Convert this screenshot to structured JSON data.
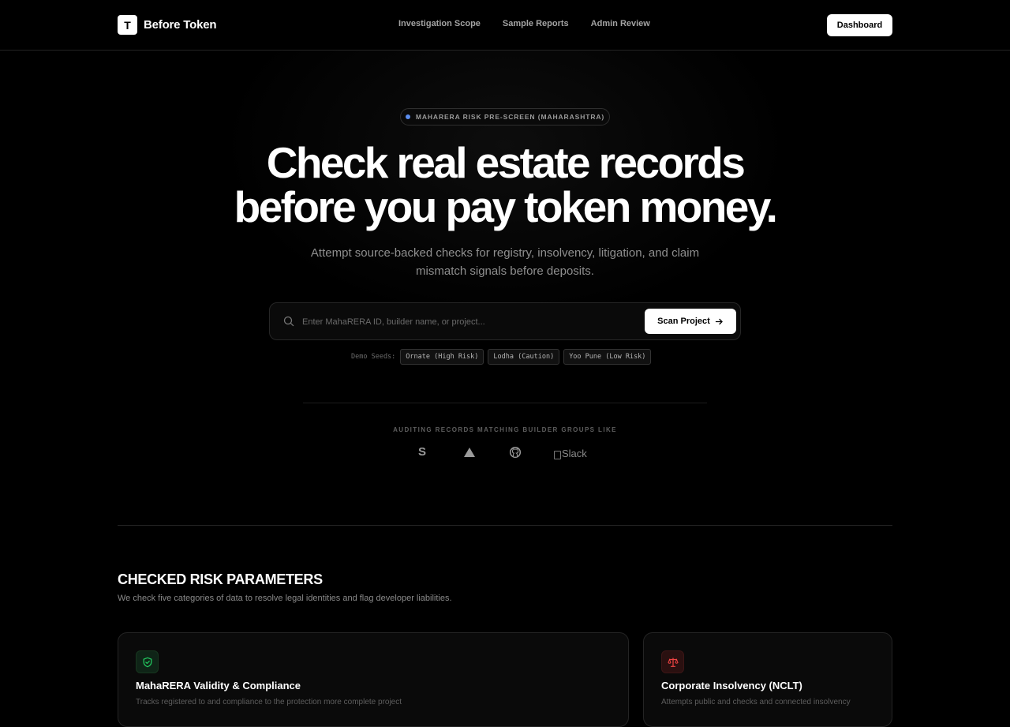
{
  "nav": {
    "brand_mark": "T",
    "brand_name": "Before Token",
    "links": [
      "Investigation Scope",
      "Sample Reports",
      "Admin Review"
    ],
    "dashboard_label": "Dashboard"
  },
  "hero": {
    "badge": "MAHARERA RISK PRE-SCREEN (MAHARASHTRA)",
    "headline_line1": "Check real estate records",
    "headline_line2": "before you pay token money.",
    "subheadline": "Attempt source-backed checks for registry, insolvency, litigation, and claim mismatch signals before deposits.",
    "search_placeholder": "Enter MahaRERA ID, builder name, or project...",
    "scan_label": "Scan Project",
    "seeds_label": "Demo Seeds:",
    "seeds": [
      "Ornate (High Risk)",
      "Lodha (Caution)",
      "Yoo Pune (Low Risk)"
    ],
    "auditing_label": "AUDITING RECORDS MATCHING BUILDER GROUPS LIKE",
    "logos": {
      "stripe_letter": "S",
      "slack_alt": "Slack"
    }
  },
  "risk_section": {
    "title": "CHECKED RISK PARAMETERS",
    "subtitle": "We check five categories of data to resolve legal identities and flag developer liabilities.",
    "cards": [
      {
        "title": "MahaRERA Validity & Compliance",
        "description": "Tracks registered to and compliance to the protection more complete project",
        "icon": "shield-check-icon",
        "accent": "#22c55e"
      },
      {
        "title": "Corporate Insolvency (NCLT)",
        "description": "Attempts public and checks and connected insolvency",
        "icon": "scales-icon",
        "accent": "#ef4444"
      }
    ]
  },
  "colors": {
    "background": "#000000",
    "badge_dot": "#5b8def",
    "accent_green": "#22c55e",
    "accent_red": "#ef4444"
  }
}
